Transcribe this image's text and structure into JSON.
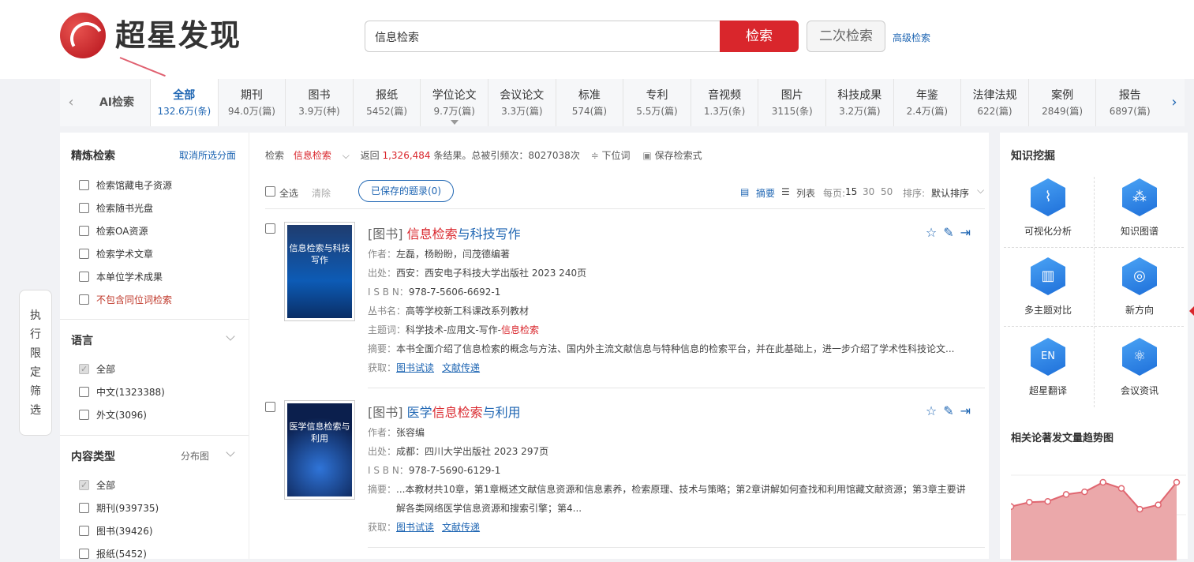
{
  "brand": {
    "name": "超星发现"
  },
  "search": {
    "value": "信息检索",
    "button": "检索",
    "second": "二次检索",
    "advanced": "高级检索"
  },
  "tabs": {
    "ai": "AI检索",
    "items": [
      {
        "label": "全部",
        "count": "132.6万(条)"
      },
      {
        "label": "期刊",
        "count": "94.0万(篇)"
      },
      {
        "label": "图书",
        "count": "3.9万(种)"
      },
      {
        "label": "报纸",
        "count": "5452(篇)"
      },
      {
        "label": "学位论文",
        "count": "9.7万(篇)"
      },
      {
        "label": "会议论文",
        "count": "3.3万(篇)"
      },
      {
        "label": "标准",
        "count": "574(篇)"
      },
      {
        "label": "专利",
        "count": "5.5万(篇)"
      },
      {
        "label": "音视频",
        "count": "1.3万(条)"
      },
      {
        "label": "图片",
        "count": "3115(条)"
      },
      {
        "label": "科技成果",
        "count": "3.2万(篇)"
      },
      {
        "label": "年鉴",
        "count": "2.4万(篇)"
      },
      {
        "label": "法律法规",
        "count": "622(篇)"
      },
      {
        "label": "案例",
        "count": "2849(篇)"
      },
      {
        "label": "报告",
        "count": "6897(篇)"
      }
    ]
  },
  "left": {
    "refine_title": "精炼检索",
    "cancel_link": "取消所选分面",
    "refine_items": [
      "检索馆藏电子资源",
      "检索随书光盘",
      "检索OA资源",
      "检索学术文章",
      "本单位学术成果",
      "不包含同位词检索"
    ],
    "lang_title": "语言",
    "lang_items": [
      "全部",
      "中文(1323388)",
      "外文(3096)"
    ],
    "type_title": "内容类型",
    "type_dist": "分布图",
    "type_items": [
      "全部",
      "期刊(939735)",
      "图书(39426)",
      "报纸(5452)"
    ],
    "side_button": [
      "执",
      "行",
      "限",
      "定",
      "筛",
      "选"
    ]
  },
  "main": {
    "meta": {
      "prefix": "检索",
      "term": "信息检索",
      "returns": "返回",
      "total": "1,326,484",
      "suffix": "条结果。总被引频次：8027038次",
      "lower": "下位词",
      "save": "保存检索式"
    },
    "tools": {
      "select_all": "全选",
      "clear": "清除",
      "saved": "已保存的题录(0)",
      "abstract": "摘要",
      "list": "列表",
      "per_page_label": "每页:",
      "per_page": [
        "15",
        "30",
        "50"
      ],
      "sort_label": "排序:",
      "sort_value": "默认排序"
    },
    "records": [
      {
        "tag": "[图书]",
        "title_red": "信息检索",
        "title_rest": "与科技写作",
        "cover_text": "信息检索与科技写作",
        "lines": [
          {
            "k": "作者：",
            "v": "左磊，杨盼盼，闫茂德编著"
          },
          {
            "k": "出处：",
            "v": "西安：西安电子科技大学出版社 2023 240页"
          },
          {
            "k": "I S B N：",
            "v": "978-7-5606-6692-1"
          },
          {
            "k": "丛书名：",
            "v": "高等学校新工科课改系列教材"
          },
          {
            "k": "主题词：",
            "v": "科学技术-应用文-写作-",
            "red": "信息检索"
          },
          {
            "k": "摘要：",
            "v": "本书全面介绍了信息检索的概念与方法、国内外主流文献信息与特种信息的检索平台，并在此基础上，进一步介绍了学术性科技论文..."
          }
        ],
        "links": [
          "图书试读",
          "文献传递"
        ]
      },
      {
        "tag": "[图书]",
        "title_pre": "医学",
        "title_red": "信息检索",
        "title_rest": "与利用",
        "cover_text": "医学信息检索与利用",
        "lines": [
          {
            "k": "作者：",
            "v": "张容编"
          },
          {
            "k": "出处：",
            "v": "成都：四川大学出版社 2023 297页"
          },
          {
            "k": "I S B N：",
            "v": "978-7-5690-6129-1"
          },
          {
            "k": "摘要：",
            "v": "...本教材共10章，第1章概述文献信息资源和信息素养，检索原理、技术与策略；第2章讲解如何查找和利用馆藏文献资源；第3章主要讲"
          },
          {
            "k": "",
            "v": "解各类网络医学信息资源和搜索引擎；第4..."
          }
        ],
        "links": [
          "图书试读",
          "文献传递"
        ]
      }
    ]
  },
  "right": {
    "title": "知识挖掘",
    "tools": [
      "可视化分析",
      "知识图谱",
      "多主题对比",
      "新方向",
      "超星翻译",
      "会议资讯"
    ],
    "trend_title": "相关论著发文量趋势图",
    "trend_values": [
      62,
      67,
      68,
      76,
      79,
      90,
      83,
      59,
      64,
      90
    ]
  },
  "colors": {
    "brand_red": "#d9262c",
    "link_blue": "#1f66b3"
  }
}
